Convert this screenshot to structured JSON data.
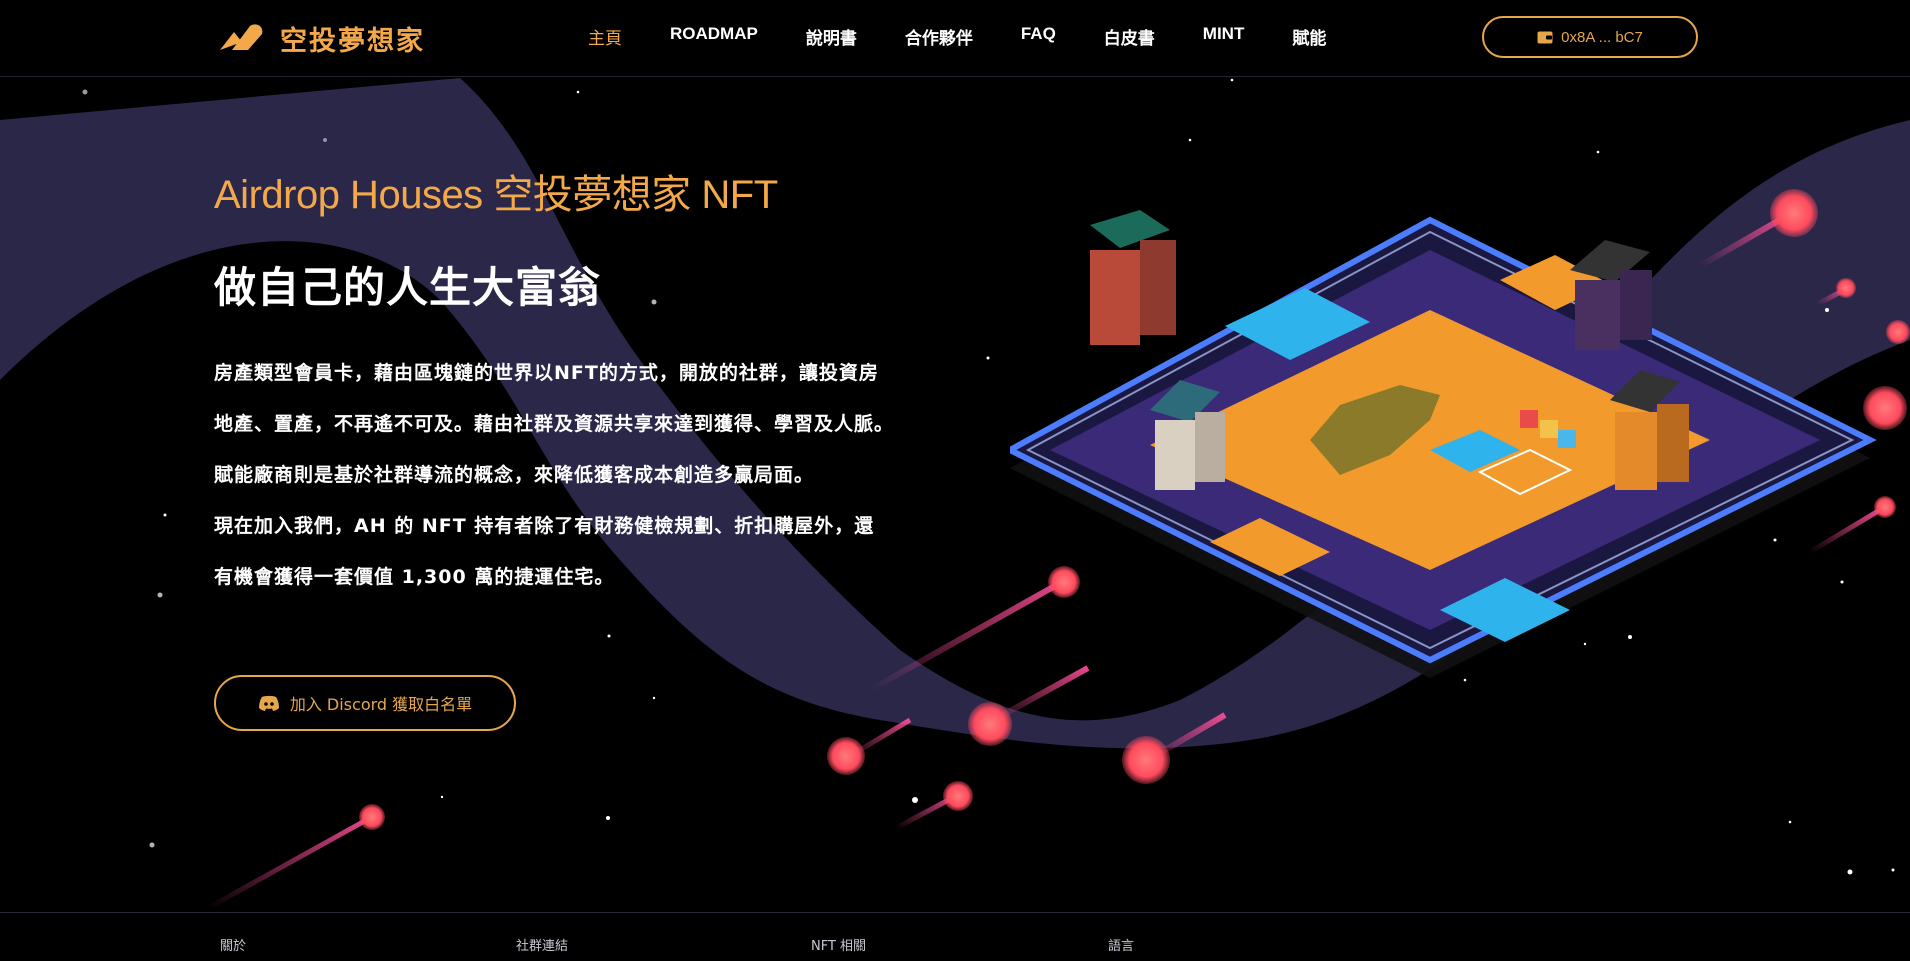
{
  "header": {
    "logo_text": "空投夢想家",
    "nav": [
      {
        "label": "主頁",
        "active": true
      },
      {
        "label": "ROADMAP"
      },
      {
        "label": "說明書"
      },
      {
        "label": "合作夥伴"
      },
      {
        "label": "FAQ"
      },
      {
        "label": "白皮書"
      },
      {
        "label": "MINT"
      },
      {
        "label": "賦能"
      }
    ],
    "wallet": {
      "icon": "wallet-icon",
      "address": "0x8A ... bC7"
    }
  },
  "hero": {
    "title": "Airdrop Houses 空投夢想家 NFT",
    "subtitle": "做自己的人生大富翁",
    "paragraphs": [
      "房產類型會員卡，藉由區塊鏈的世界以NFT的方式，開放的社群，讓投資房地產、置產，不再遙不可及。藉由社群及資源共享來達到獲得、學習及人脈。賦能廠商則是基於社群導流的概念，來降低獲客成本創造多贏局面。",
      "現在加入我們，AH 的 NFT 持有者除了有財務健檢規劃、折扣購屋外，還有機會獲得一套價值 1,300 萬的捷運住宅。"
    ],
    "cta": {
      "icon": "discord-icon",
      "label": "加入 Discord 獲取白名單"
    }
  },
  "footer": {
    "columns": [
      "關於",
      "社群連結",
      "NFT 相關",
      "語言"
    ]
  },
  "colors": {
    "accent": "#f3a94a",
    "purple_wave": "#2b2749",
    "meteor": "#ff5a7a"
  }
}
